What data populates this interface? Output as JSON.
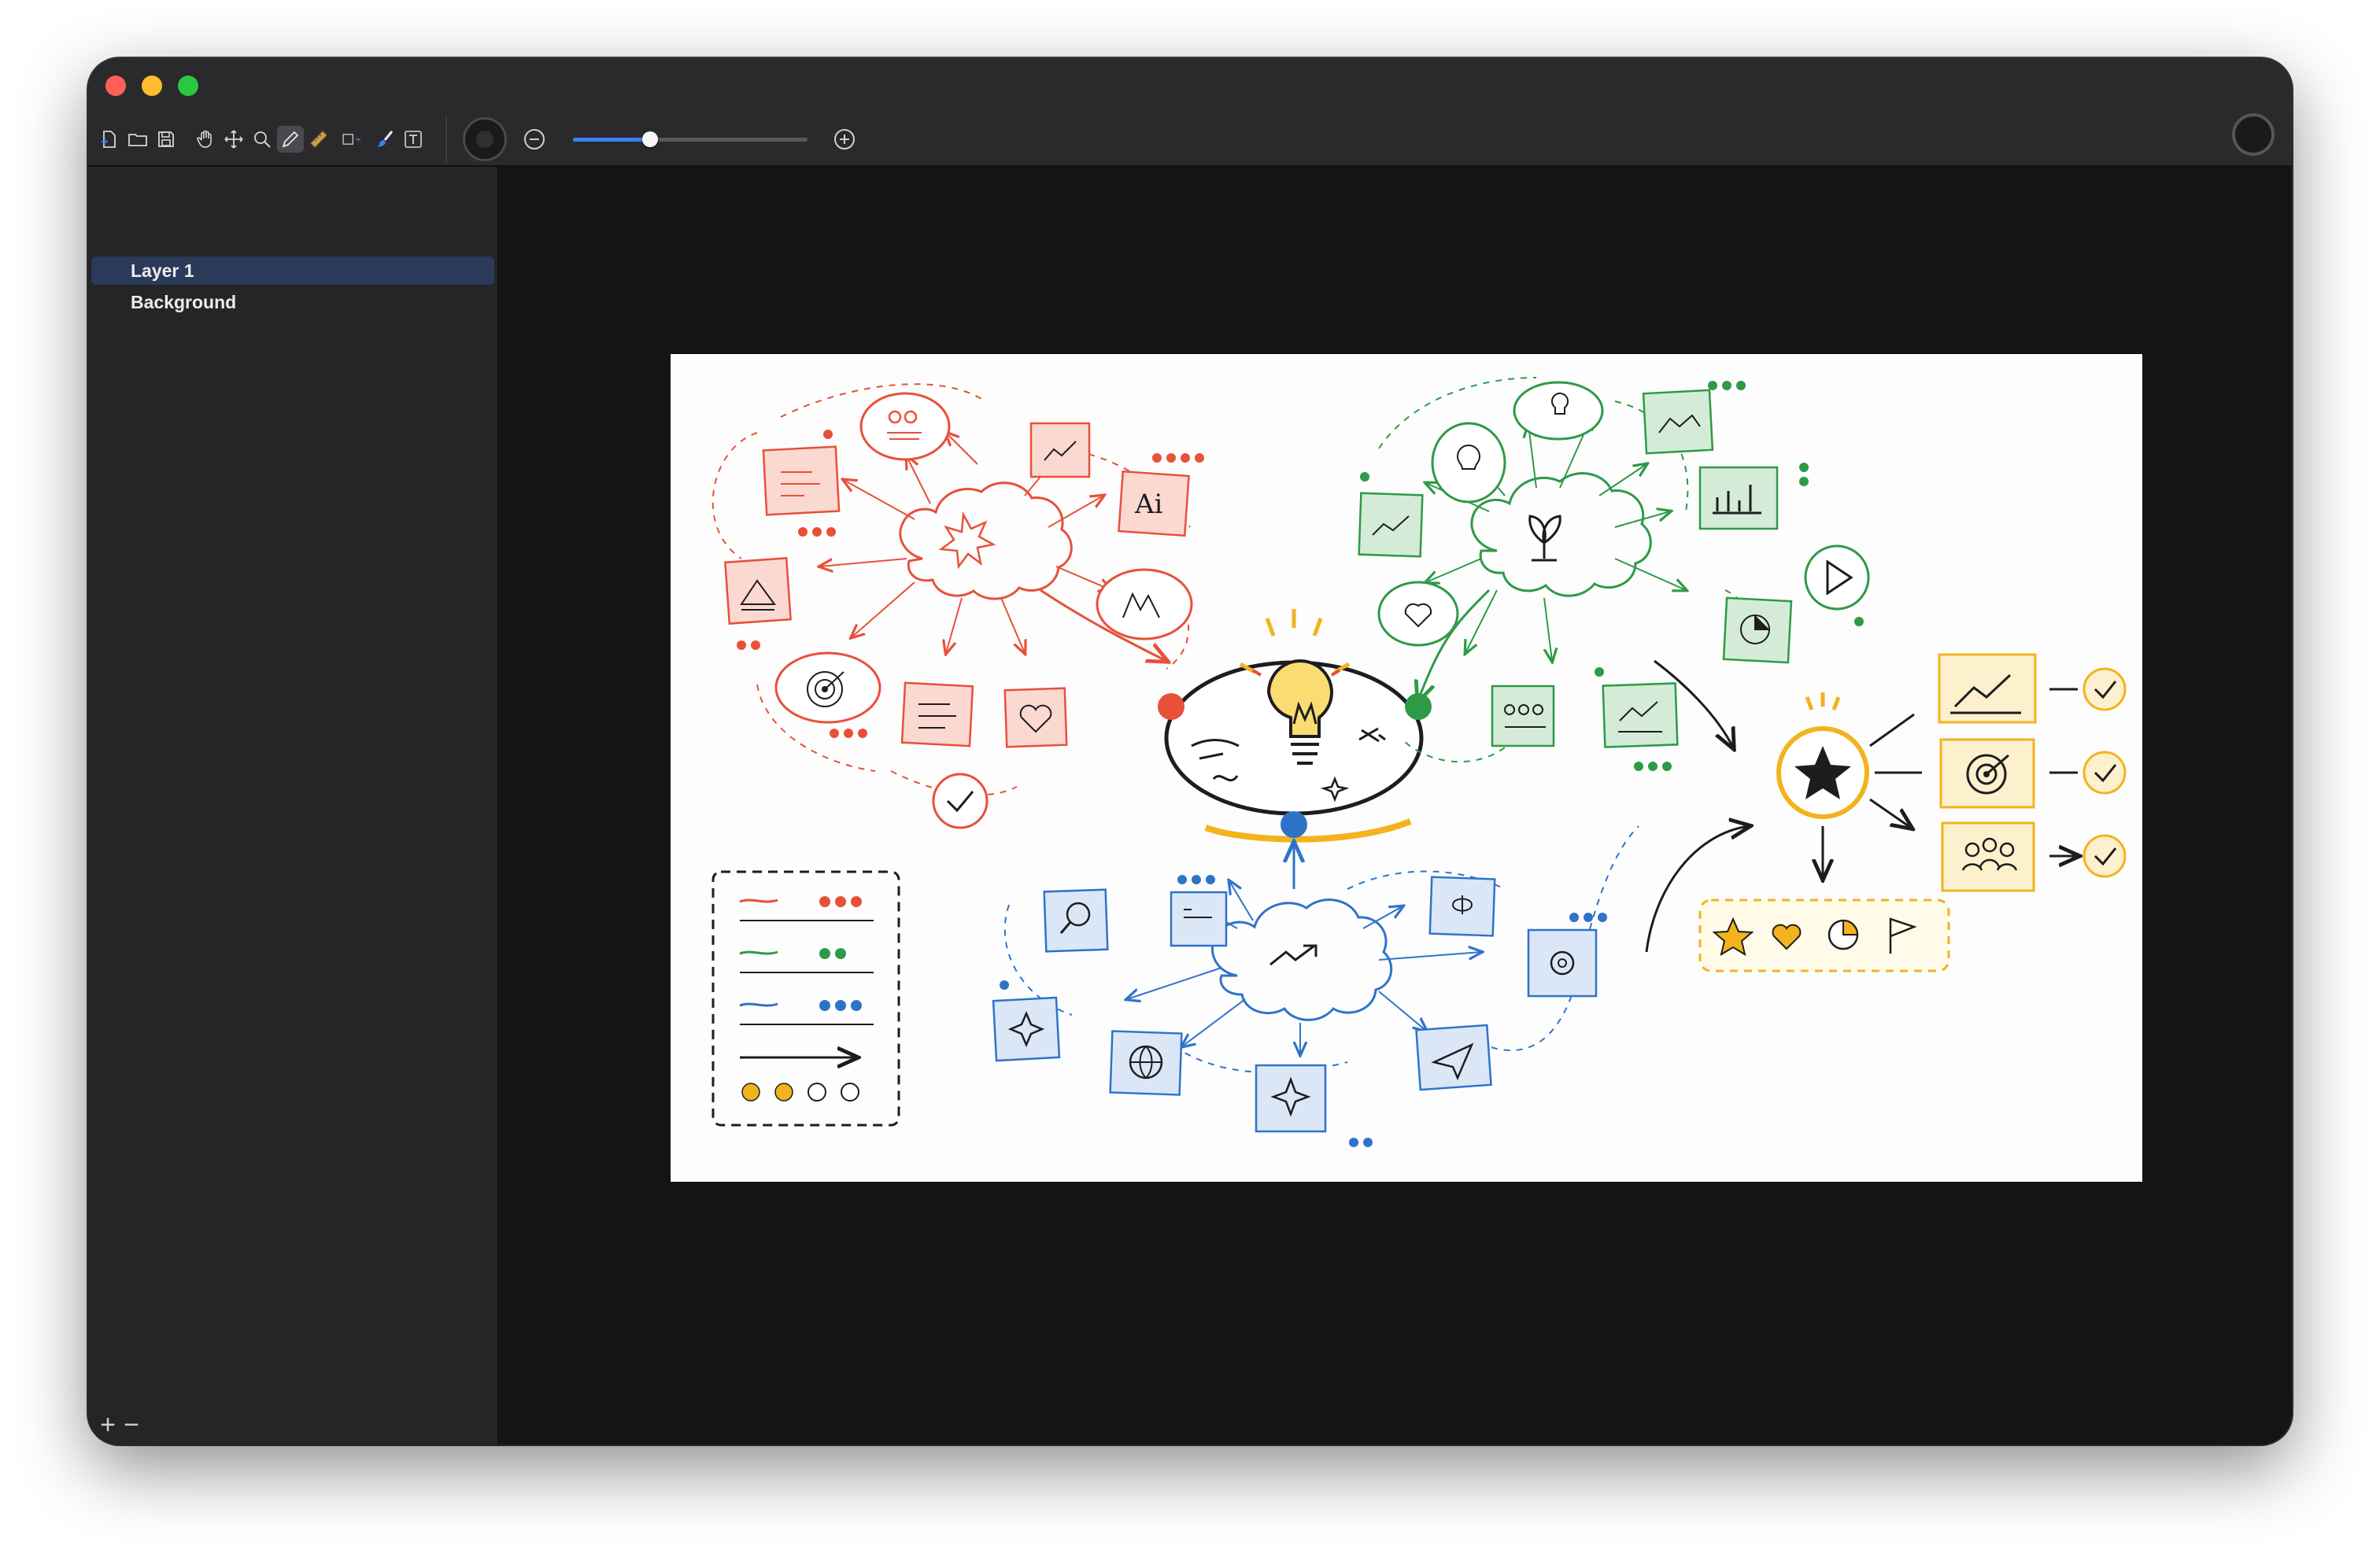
{
  "window": {
    "traffic_lights": {
      "close": "#ff5f57",
      "minimize": "#febc2e",
      "maximize": "#28c840"
    }
  },
  "toolbar": {
    "tools": [
      "new-file-icon",
      "open-folder-icon",
      "save-icon",
      "hand-tool-icon",
      "move-tool-icon",
      "zoom-tool-icon",
      "pencil-tool-icon",
      "ruler-tool-icon",
      "shape-tool-icon",
      "brush-tool-icon",
      "text-tool-icon"
    ],
    "active_tool": "pencil-tool-icon",
    "zoom_level": 0.33,
    "accent": "#3a82f7"
  },
  "layers": {
    "items": [
      {
        "label": "Layer 1",
        "selected": true
      },
      {
        "label": "Background",
        "selected": false
      }
    ],
    "add_label": "+",
    "remove_label": "−"
  },
  "document": {
    "colors": {
      "red": "#e8503a",
      "green": "#2e9a47",
      "blue": "#2f73c9",
      "yellow": "#f2b31d",
      "ink": "#1d1d1f"
    }
  }
}
